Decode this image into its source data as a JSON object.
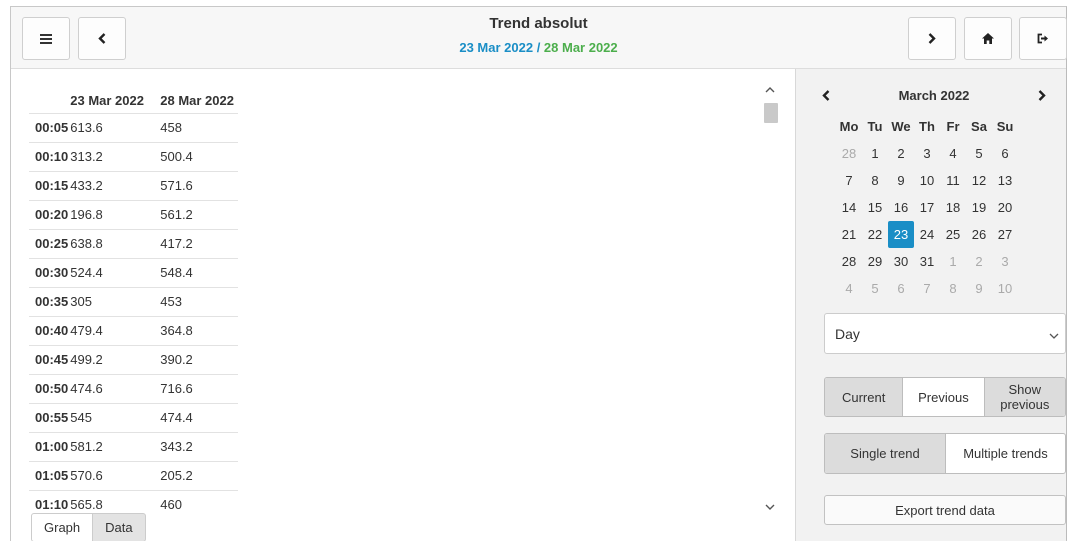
{
  "header": {
    "title": "Trend absolut",
    "date1": "23 Mar 2022",
    "separator": " / ",
    "date2": "28 Mar 2022",
    "colors": {
      "date1": "#1a8ec6",
      "date2": "#4cae4c"
    },
    "buttons": {
      "menu_icon": "menu-icon",
      "back_icon": "chevron-left-icon",
      "forward_icon": "chevron-right-icon",
      "home_icon": "home-icon",
      "logout_icon": "logout-icon"
    }
  },
  "table": {
    "headers": [
      "",
      "23 Mar 2022",
      "28 Mar 2022"
    ],
    "rows": [
      [
        "00:05",
        "613.6",
        "458"
      ],
      [
        "00:10",
        "313.2",
        "500.4"
      ],
      [
        "00:15",
        "433.2",
        "571.6"
      ],
      [
        "00:20",
        "196.8",
        "561.2"
      ],
      [
        "00:25",
        "638.8",
        "417.2"
      ],
      [
        "00:30",
        "524.4",
        "548.4"
      ],
      [
        "00:35",
        "305",
        "453"
      ],
      [
        "00:40",
        "479.4",
        "364.8"
      ],
      [
        "00:45",
        "499.2",
        "390.2"
      ],
      [
        "00:50",
        "474.6",
        "716.6"
      ],
      [
        "00:55",
        "545",
        "474.4"
      ],
      [
        "01:00",
        "581.2",
        "343.2"
      ],
      [
        "01:05",
        "570.6",
        "205.2"
      ],
      [
        "01:10",
        "565.8",
        "460"
      ]
    ]
  },
  "tabs": {
    "graph": "Graph",
    "data": "Data",
    "active": "Data"
  },
  "calendar": {
    "month": "March 2022",
    "weekdays": [
      "Mo",
      "Tu",
      "We",
      "Th",
      "Fr",
      "Sa",
      "Su"
    ],
    "days": [
      {
        "n": "28",
        "other": true
      },
      {
        "n": "1"
      },
      {
        "n": "2"
      },
      {
        "n": "3"
      },
      {
        "n": "4"
      },
      {
        "n": "5"
      },
      {
        "n": "6"
      },
      {
        "n": "7"
      },
      {
        "n": "8"
      },
      {
        "n": "9"
      },
      {
        "n": "10"
      },
      {
        "n": "11"
      },
      {
        "n": "12"
      },
      {
        "n": "13"
      },
      {
        "n": "14"
      },
      {
        "n": "15"
      },
      {
        "n": "16"
      },
      {
        "n": "17"
      },
      {
        "n": "18"
      },
      {
        "n": "19"
      },
      {
        "n": "20"
      },
      {
        "n": "21"
      },
      {
        "n": "22"
      },
      {
        "n": "23",
        "selected": true
      },
      {
        "n": "24"
      },
      {
        "n": "25"
      },
      {
        "n": "26"
      },
      {
        "n": "27"
      },
      {
        "n": "28"
      },
      {
        "n": "29"
      },
      {
        "n": "30"
      },
      {
        "n": "31"
      },
      {
        "n": "1",
        "other": true
      },
      {
        "n": "2",
        "other": true
      },
      {
        "n": "3",
        "other": true
      },
      {
        "n": "4",
        "other": true
      },
      {
        "n": "5",
        "other": true
      },
      {
        "n": "6",
        "other": true
      },
      {
        "n": "7",
        "other": true
      },
      {
        "n": "8",
        "other": true
      },
      {
        "n": "9",
        "other": true
      },
      {
        "n": "10",
        "other": true
      }
    ],
    "selected_color": "#1a8ec6"
  },
  "period_select": {
    "value": "Day"
  },
  "compare_group": {
    "current": "Current",
    "previous": "Previous",
    "show_previous": "Show previous",
    "active": "Current"
  },
  "trend_group": {
    "single": "Single trend",
    "multiple": "Multiple trends",
    "active": "Single trend"
  },
  "export_button": "Export trend data"
}
